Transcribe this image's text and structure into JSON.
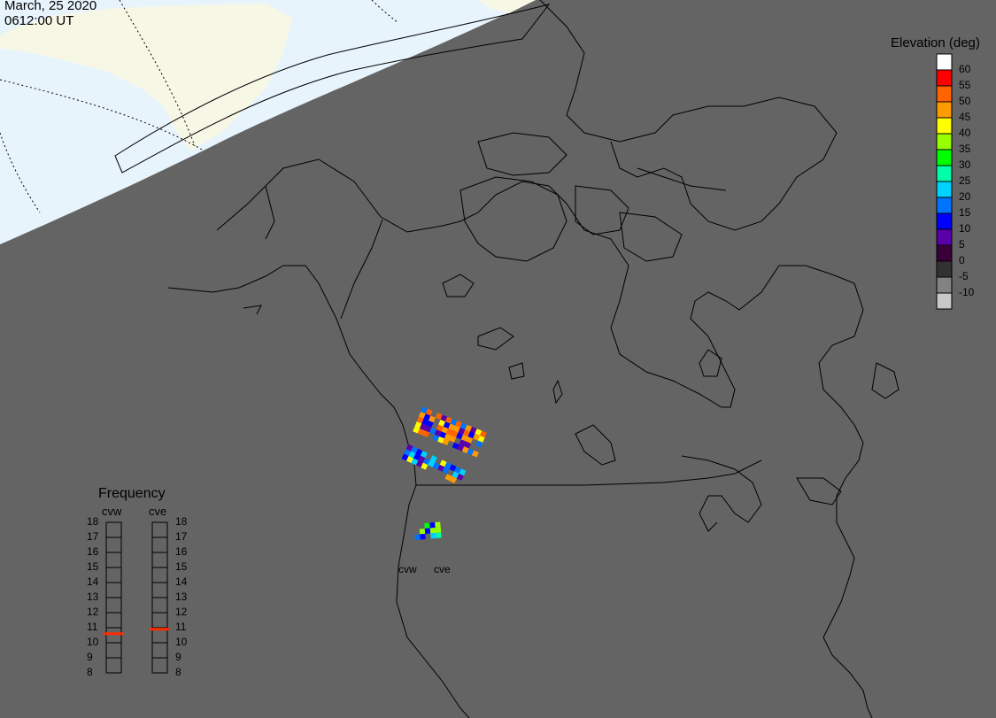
{
  "header": {
    "date": "March, 25 2020",
    "time": "0612:00 UT"
  },
  "legend": {
    "title": "Elevation (deg)",
    "scale": [
      {
        "label": "60",
        "color": "#ffffff"
      },
      {
        "label": "55",
        "color": "#ff0000"
      },
      {
        "label": "50",
        "color": "#ff6400"
      },
      {
        "label": "45",
        "color": "#ff9b00"
      },
      {
        "label": "40",
        "color": "#ffff00"
      },
      {
        "label": "35",
        "color": "#96ff00"
      },
      {
        "label": "30",
        "color": "#00ff00"
      },
      {
        "label": "25",
        "color": "#00ffaa"
      },
      {
        "label": "20",
        "color": "#00d2ff"
      },
      {
        "label": "15",
        "color": "#0073ff"
      },
      {
        "label": "10",
        "color": "#0000ff"
      },
      {
        "label": "5",
        "color": "#5a00aa"
      },
      {
        "label": "0",
        "color": "#3a003a"
      },
      {
        "label": "-5",
        "color": "#323232"
      },
      {
        "label": "-10",
        "color": "#828282"
      },
      {
        "label": "",
        "color": "#c8c8c8"
      }
    ]
  },
  "frequency": {
    "title": "Frequency",
    "radars": [
      {
        "name": "cvw",
        "value": 10.6
      },
      {
        "name": "cve",
        "value": 10.9
      }
    ],
    "ticks": [
      "18",
      "17",
      "16",
      "15",
      "14",
      "13",
      "12",
      "11",
      "10",
      "9",
      "8"
    ]
  },
  "map_labels": {
    "radar_west": "cvw",
    "radar_east": "cve"
  },
  "colors": {
    "night": "#646464",
    "sunlit_ocean": "#e8f4fc",
    "sunlit_land": "#f7f7e6",
    "coastline": "#000000",
    "frequency_marker": "#ff2a00"
  }
}
